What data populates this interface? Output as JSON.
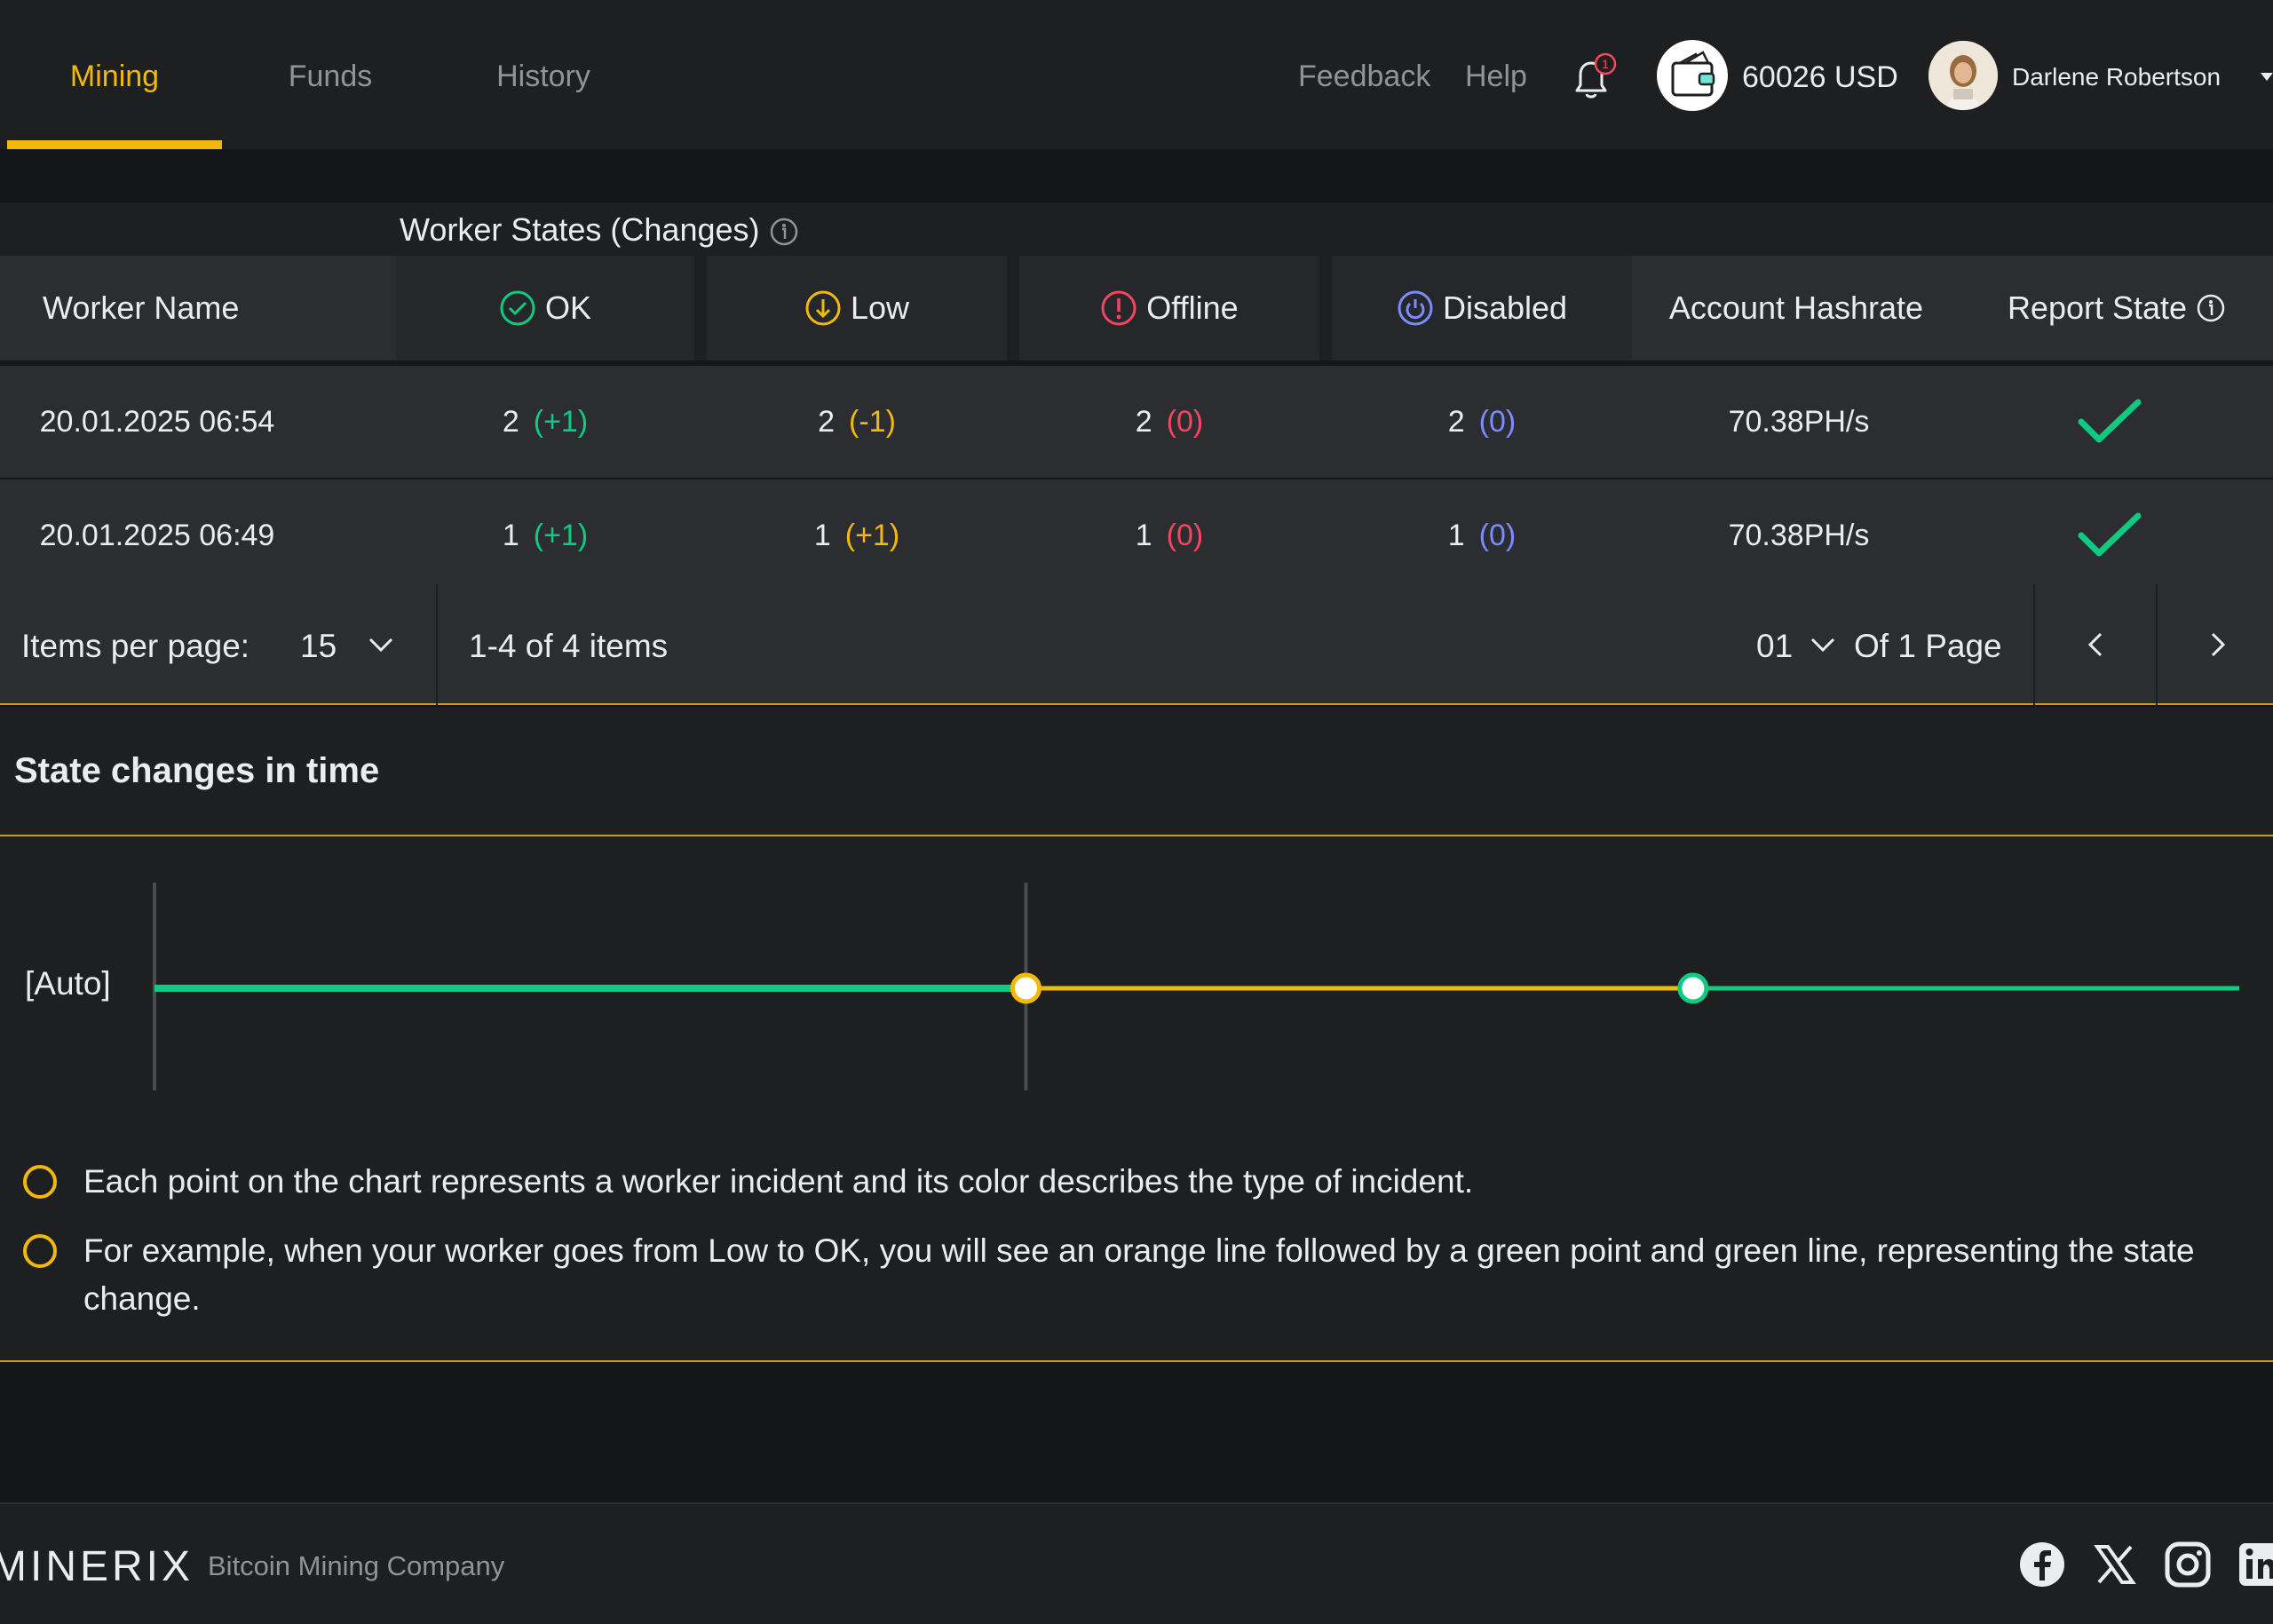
{
  "nav": {
    "tabs": [
      {
        "label": "Mining",
        "active": true
      },
      {
        "label": "Funds",
        "active": false
      },
      {
        "label": "History",
        "active": false
      }
    ],
    "feedback": "Feedback",
    "help": "Help",
    "notification_count": "1",
    "balance": "60026 USD",
    "user_name": "Darlene Robertson"
  },
  "table": {
    "group_title": "Worker States (Changes)",
    "headers": {
      "worker_name": "Worker Name",
      "ok": "OK",
      "low": "Low",
      "offline": "Offline",
      "disabled": "Disabled",
      "account_hashrate": "Account Hashrate",
      "report_state": "Report State"
    },
    "rows": [
      {
        "worker": "20.01.2025 06:54",
        "ok": "2",
        "ok_change": "(+1)",
        "low": "2",
        "low_change": "(-1)",
        "offline": "2",
        "offline_change": "(0)",
        "disabled": "2",
        "disabled_change": "(0)",
        "hashrate": "70.38PH/s"
      },
      {
        "worker": "20.01.2025 06:49",
        "ok": "1",
        "ok_change": "(+1)",
        "low": "1",
        "low_change": "(+1)",
        "offline": "1",
        "offline_change": "(0)",
        "disabled": "1",
        "disabled_change": "(0)",
        "hashrate": "70.38PH/s"
      }
    ]
  },
  "pagination": {
    "items_per_page_label": "Items per page:",
    "items_per_page": "15",
    "range": "1-4 of 4 items",
    "current_page": "01",
    "of_pages": "Of 1 Page"
  },
  "state_chart": {
    "title": "State changes in time",
    "series_label": "[Auto]",
    "notes": [
      "Each point on the chart represents a worker incident and its color describes the type of incident.",
      "For example, when your worker goes from Low to OK, you will see an orange line followed by a green point and green line, representing the state change."
    ]
  },
  "chart_data": {
    "type": "line",
    "title": "State changes in time",
    "series": [
      {
        "name": "[Auto]",
        "segments": [
          {
            "state": "OK",
            "from": 0.0,
            "to": 0.418
          },
          {
            "state": "Low",
            "from": 0.418,
            "to": 0.738
          },
          {
            "state": "OK",
            "from": 0.738,
            "to": 1.0
          }
        ],
        "points": [
          0.418,
          0.738
        ]
      }
    ],
    "colors": {
      "OK": "#0ecb81",
      "Low": "#f0b90b"
    }
  },
  "footer": {
    "logo": "MINERIX",
    "tagline": "Bitcoin Mining Company",
    "social": [
      "facebook-icon",
      "x-icon",
      "instagram-icon",
      "linkedin-icon"
    ]
  },
  "colors": {
    "accent": "#f0b90b",
    "ok": "#0ecb81",
    "low": "#f0b90b",
    "offline": "#f6465d",
    "disabled": "#7b8cff"
  }
}
